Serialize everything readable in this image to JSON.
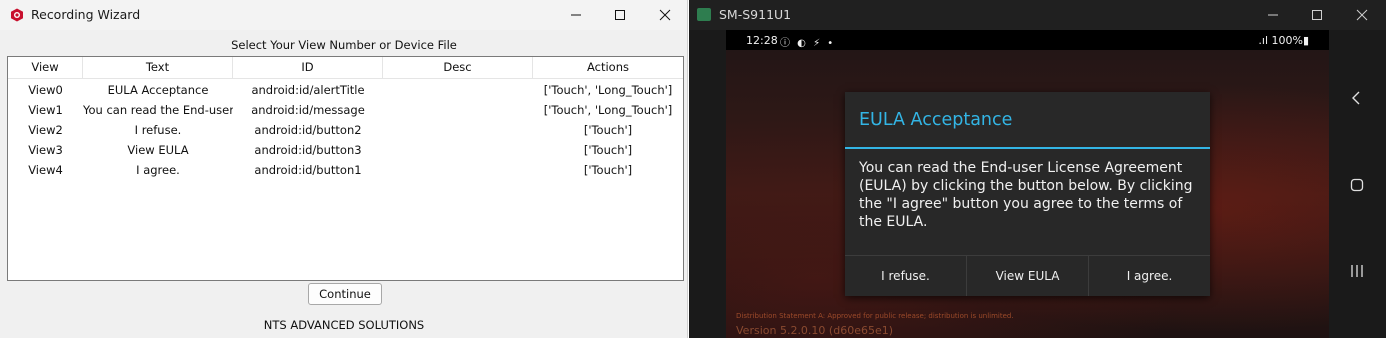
{
  "left_window": {
    "title": "Recording Wizard",
    "prompt": "Select Your View Number or Device File",
    "table": {
      "headers": [
        "View",
        "Text",
        "ID",
        "Desc",
        "Actions"
      ],
      "rows": [
        [
          "View0",
          "EULA Acceptance",
          "android:id/alertTitle",
          "",
          "['Touch', 'Long_Touch']"
        ],
        [
          "View1",
          "You can read the End-user",
          "android:id/message",
          "",
          "['Touch', 'Long_Touch']"
        ],
        [
          "View2",
          "I refuse.",
          "android:id/button2",
          "",
          "['Touch']"
        ],
        [
          "View3",
          "View EULA",
          "android:id/button3",
          "",
          "['Touch']"
        ],
        [
          "View4",
          "I agree.",
          "android:id/button1",
          "",
          "['Touch']"
        ]
      ]
    },
    "continue_label": "Continue",
    "company": "NTS ADVANCED SOLUTIONS",
    "icon": "app-logo-icon",
    "accent_color": "#c8102e"
  },
  "right_window": {
    "title": "SM-S911U1",
    "status_bar": {
      "time": "12:28",
      "icons": "ⓘ ◐ ⚡ •",
      "right": ".ıl 100%▮"
    },
    "dialog": {
      "title": "EULA Acceptance",
      "message": "You can read the End-user License Agreement (EULA) by clicking the button below. By clicking the \"I agree\" button you agree to the terms of the EULA.",
      "buttons": [
        "I refuse.",
        "View EULA",
        "I agree."
      ],
      "accent_color": "#33b5e5"
    },
    "distribution_text": "Distribution Statement A: Approved for public release; distribution is unlimited.",
    "version_text": "Version 5.2.0.10 (d60e65e1)",
    "nav_icons": [
      "back-icon",
      "home-icon",
      "recents-icon"
    ]
  }
}
